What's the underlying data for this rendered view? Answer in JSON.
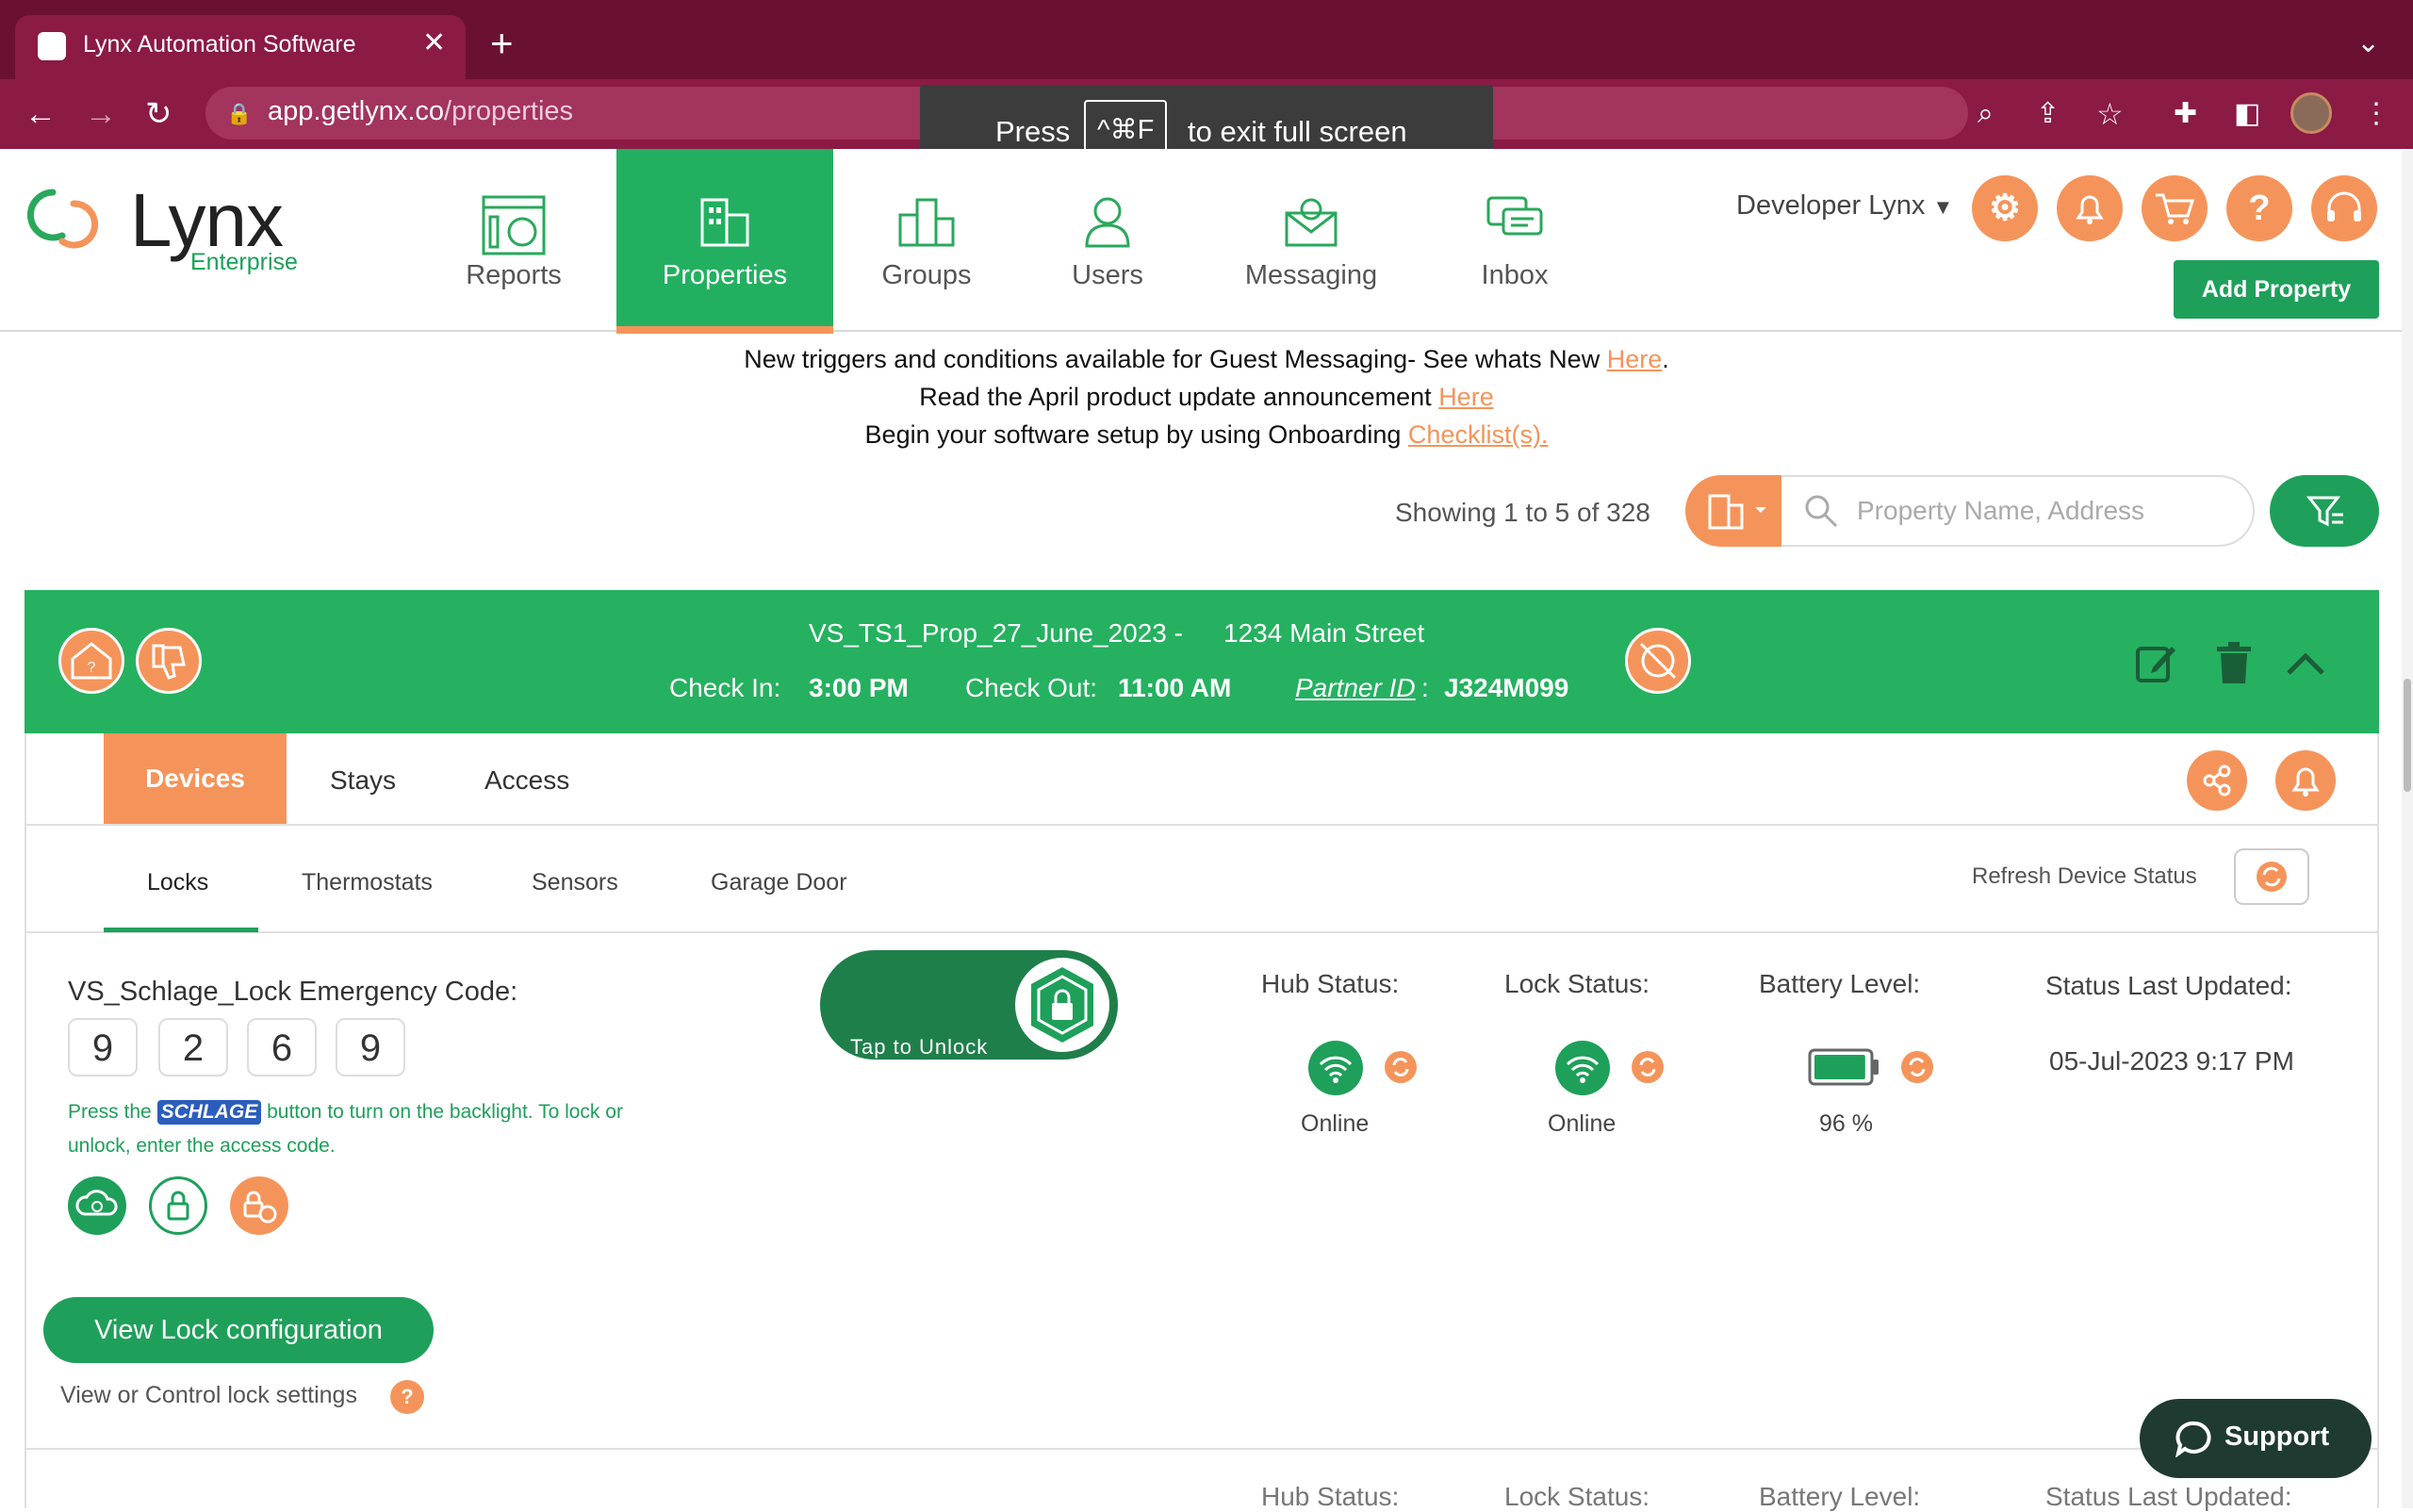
{
  "browser": {
    "tab_title": "Lynx Automation Software",
    "url_host": "app.getlynx.co",
    "url_path": "/properties",
    "fullscreen_toast": {
      "press": "Press",
      "keys": "^⌘F",
      "suffix": "to exit full screen"
    }
  },
  "header": {
    "logo_text": "Lynx",
    "logo_sub": "Enterprise",
    "nav": [
      {
        "label": "Reports",
        "icon": "reports-icon"
      },
      {
        "label": "Properties",
        "icon": "properties-icon",
        "active": true
      },
      {
        "label": "Groups",
        "icon": "groups-icon"
      },
      {
        "label": "Users",
        "icon": "users-icon"
      },
      {
        "label": "Messaging",
        "icon": "messaging-icon"
      },
      {
        "label": "Inbox",
        "icon": "inbox-icon"
      }
    ],
    "account_name": "Developer Lynx",
    "add_property_label": "Add Property",
    "help_glyph": "?"
  },
  "announcements": {
    "line1_text": "New triggers and conditions available for Guest Messaging- See whats New",
    "line1_link": "Here",
    "line1_end": ".",
    "line2_text": "Read the April product update announcement",
    "line2_link": "Here",
    "line3_text": "Begin your software setup by using Onboarding",
    "line3_link": "Checklist(s)."
  },
  "listing": {
    "showing": "Showing 1 to 5 of 328",
    "search_placeholder": "Property Name, Address"
  },
  "property": {
    "name": "VS_TS1_Prop_27_June_2023 -",
    "address": "1234 Main Street",
    "check_in_label": "Check In:",
    "check_in": "3:00 PM",
    "check_out_label": "Check Out:",
    "check_out": "11:00 AM",
    "partner_label": "Partner ID",
    "partner_sep": ":",
    "partner_id": "J324M099",
    "tabs": [
      "Devices",
      "Stays",
      "Access"
    ],
    "subtabs": [
      "Locks",
      "Thermostats",
      "Sensors",
      "Garage Door"
    ],
    "refresh_label": "Refresh Device Status"
  },
  "lock": {
    "emergency_title": "VS_Schlage_Lock Emergency Code:",
    "code_digits": [
      "9",
      "2",
      "6",
      "9"
    ],
    "note_before": "Press the",
    "brand": "SCHLAGE",
    "note_after": "button to turn on the backlight. To lock or unlock, enter the access code.",
    "unlock_label": "Tap to Unlock",
    "hub_status_label": "Hub Status:",
    "hub_status": "Online",
    "lock_status_label": "Lock Status:",
    "lock_status": "Online",
    "battery_label": "Battery Level:",
    "battery": "96 %",
    "battery_fraction": 0.96,
    "updated_label": "Status Last Updated:",
    "updated": "05-Jul-2023 9:17 PM",
    "view_config_label": "View Lock configuration",
    "view_config_note": "View or Control lock settings",
    "help_glyph": "?"
  },
  "next_row": {
    "hub_status_label": "Hub Status:",
    "lock_status_label": "Lock Status:",
    "battery_label": "Battery Level:",
    "updated_label": "Status Last Updated:"
  },
  "support_label": "Support",
  "colors": {
    "brand_green": "#1ea05a",
    "accent_orange": "#f5945a",
    "chrome": "#6a1133"
  }
}
